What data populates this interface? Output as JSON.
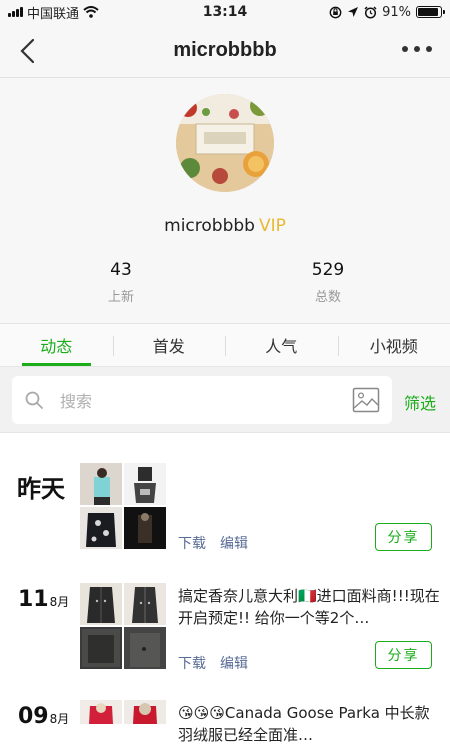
{
  "status_bar": {
    "carrier": "中国联通",
    "time": "13:14",
    "battery_percent": "91%",
    "battery_level": 0.91,
    "icons": [
      "signal-icon",
      "wifi-icon",
      "rotation-lock-icon",
      "location-icon",
      "alarm-icon",
      "battery-icon"
    ]
  },
  "nav": {
    "title": "microbbbb",
    "back_icon": "chevron-left-icon",
    "more_icon": "more-dots-icon"
  },
  "profile": {
    "username": "microbbbb",
    "vip_label": "VIP",
    "stats": [
      {
        "value": "43",
        "label": "上新"
      },
      {
        "value": "529",
        "label": "总数"
      }
    ]
  },
  "tabs": [
    {
      "label": "动态",
      "active": true
    },
    {
      "label": "首发",
      "active": false
    },
    {
      "label": "人气",
      "active": false
    },
    {
      "label": "小视频",
      "active": false
    }
  ],
  "search": {
    "placeholder": "搜索",
    "filter_label": "筛选"
  },
  "posts": [
    {
      "date_label": "昨天",
      "text": "",
      "download_label": "下载",
      "edit_label": "编辑",
      "share_label": "分享"
    },
    {
      "day": "11",
      "month": "8月",
      "text": "搞定香奈儿意大利🇮🇹进口面料商!!!现在开启预定!! 给你一个等2个…",
      "download_label": "下载",
      "edit_label": "编辑",
      "share_label": "分享"
    },
    {
      "day": "09",
      "month": "8月",
      "text": "😘😘😘Canada Goose Parka 中长款羽绒服已经全面准…"
    }
  ],
  "colors": {
    "accent_green": "#1aad19",
    "vip_gold": "#e8b931",
    "link_blue": "#576b95"
  }
}
